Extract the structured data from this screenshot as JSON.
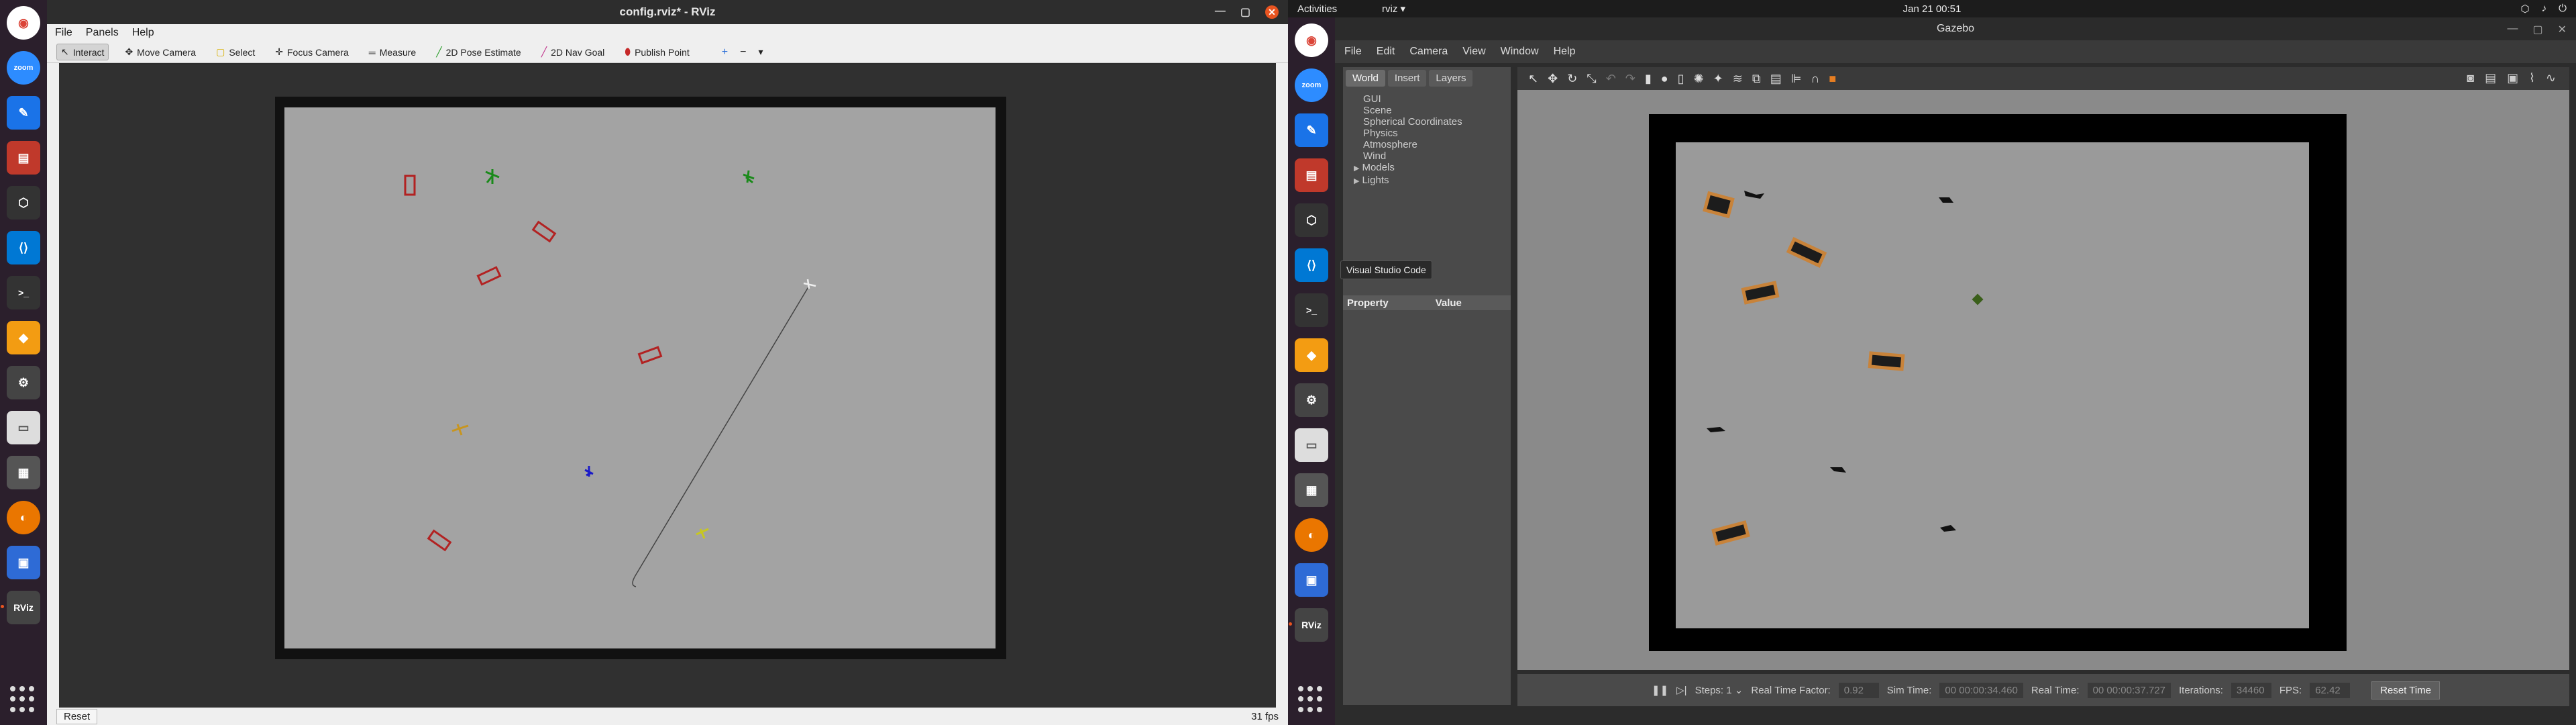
{
  "rviz": {
    "title": "config.rviz* - RViz",
    "menus": [
      "File",
      "Panels",
      "Help"
    ],
    "tools": [
      {
        "label": "Interact",
        "glyph": "↖",
        "active": true
      },
      {
        "label": "Move Camera",
        "glyph": "✥"
      },
      {
        "label": "Select",
        "glyph": "▢"
      },
      {
        "label": "Focus Camera",
        "glyph": "✛"
      },
      {
        "label": "Measure",
        "glyph": "═"
      },
      {
        "label": "2D Pose Estimate",
        "glyph": "╱"
      },
      {
        "label": "2D Nav Goal",
        "glyph": "╱"
      },
      {
        "label": "Publish Point",
        "glyph": "📍"
      }
    ],
    "extra_tools": [
      "+",
      "−",
      "▾"
    ],
    "reset_label": "Reset",
    "fps": "31 fps"
  },
  "topbar": {
    "activities": "Activities",
    "app": "rviz ▾",
    "clock": "Jan 21  00:51"
  },
  "gazebo": {
    "title": "Gazebo",
    "menus": [
      "File",
      "Edit",
      "Camera",
      "View",
      "Window",
      "Help"
    ],
    "tabs": [
      "World",
      "Insert",
      "Layers"
    ],
    "tree": [
      "GUI",
      "Scene",
      "Spherical Coordinates",
      "Physics",
      "Atmosphere",
      "Wind",
      "Models",
      "Lights"
    ],
    "tooltip": "Visual Studio Code",
    "prop_header": [
      "Property",
      "Value"
    ],
    "bottom": {
      "steps_label": "Steps: 1 ⌄",
      "rtf_label": "Real Time Factor:",
      "rtf_value": "0.92",
      "sim_label": "Sim Time:",
      "sim_value": "00 00:00:34.460",
      "real_label": "Real Time:",
      "real_value": "00 00:00:37.727",
      "iter_label": "Iterations:",
      "iter_value": "34460",
      "fps_label": "FPS:",
      "fps_value": "62.42",
      "reset_label": "Reset Time"
    }
  },
  "dock_icons": [
    "chrome-icon",
    "zoom-icon",
    "editor-icon",
    "monitor-icon",
    "unity-icon",
    "vscode-icon",
    "terminal-icon",
    "layers-icon",
    "robot-icon",
    "files-icon",
    "video-icon",
    "blender-icon",
    "screenshot-icon",
    "rviz-icon"
  ],
  "colors": {
    "accent": "#e95420",
    "dock": "#2b1f2c",
    "grid_bg": "#a3a3a3",
    "obstacle": "#b22222"
  }
}
